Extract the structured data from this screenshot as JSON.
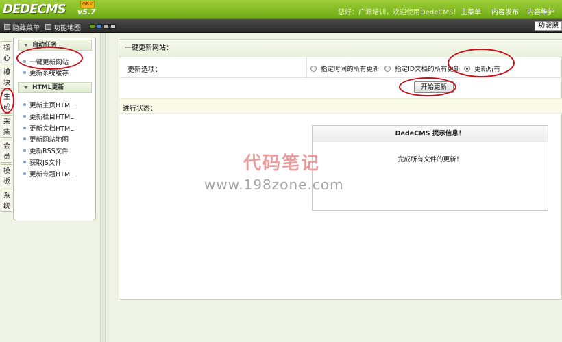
{
  "header": {
    "logo": "DEDECMS",
    "version": "v5.7",
    "badge": "GBK",
    "welcome": "您好：广源培训，欢迎使用DedeCMS！",
    "links": [
      "主菜单",
      "内容发布",
      "内容维护"
    ]
  },
  "toolbar": {
    "hide_menu": "隐藏菜单",
    "function_map": "功能地图",
    "function_map_button": "功能搜"
  },
  "colors": {
    "header_green": "#7ab51d",
    "swatches": [
      "#5c9f12",
      "#4a86c8",
      "#b0b0b0",
      "#d0d0d0"
    ],
    "annotation_red": "#c8101a"
  },
  "vtabs": [
    {
      "label": "核心",
      "active": false
    },
    {
      "label": "模块",
      "active": false
    },
    {
      "label": "生成",
      "active": true
    },
    {
      "label": "采集",
      "active": false
    },
    {
      "label": "会员",
      "active": false
    },
    {
      "label": "模板",
      "active": false
    },
    {
      "label": "系统",
      "active": false
    }
  ],
  "menu": {
    "groups": [
      {
        "title": "自动任务",
        "items": [
          "一键更新网站",
          "更新系统缓存"
        ]
      },
      {
        "title": "HTML更新",
        "items": [
          "更新主页HTML",
          "更新栏目HTML",
          "更新文档HTML",
          "更新网站地图",
          "更新RSS文件",
          "获取JS文件",
          "更新专题HTML"
        ]
      }
    ]
  },
  "main": {
    "title": "一键更新网站：",
    "options_label": "更新选项：",
    "radio_options": [
      {
        "label": "指定时间的所有更新",
        "checked": false
      },
      {
        "label": "指定ID文档的所有更新",
        "checked": false
      },
      {
        "label": "更新所有",
        "checked": true
      }
    ],
    "start_button": "开始更新",
    "status_label": "进行状态：",
    "info_box": {
      "title": "DedeCMS 提示信息！",
      "message": "完成所有文件的更新！"
    }
  },
  "watermark": {
    "chinese": "代码笔记",
    "url": "www.198zone.com"
  }
}
